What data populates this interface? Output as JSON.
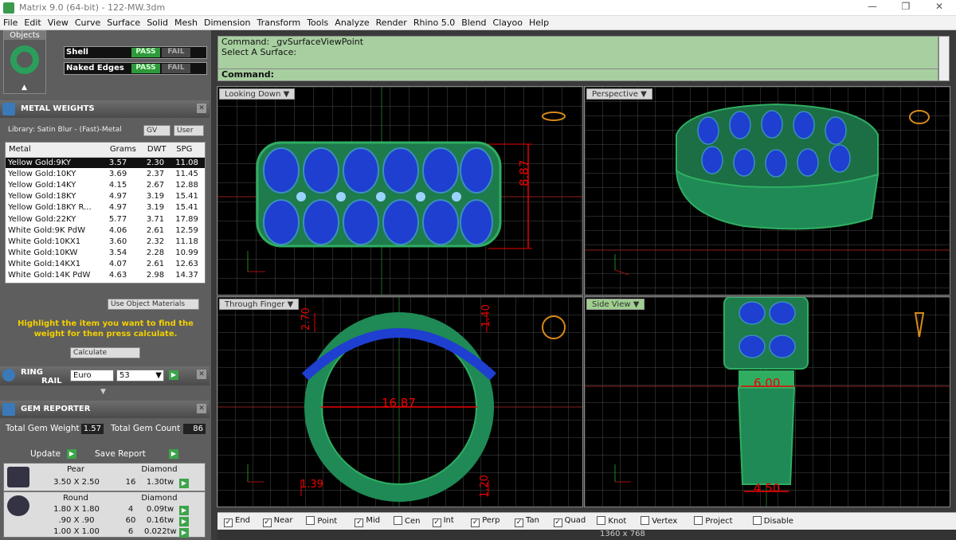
{
  "window": {
    "title": "Matrix 9.0 (64-bit) - 122-MW.3dm"
  },
  "menu": [
    "File",
    "Edit",
    "View",
    "Curve",
    "Surface",
    "Solid",
    "Mesh",
    "Dimension",
    "Transform",
    "Tools",
    "Analyze",
    "Render",
    "Rhino 5.0",
    "Blend",
    "Clayoo",
    "Help"
  ],
  "objects": {
    "label": "Objects"
  },
  "checks": [
    {
      "name": "Shell",
      "pass": "PASS",
      "fail": "FAIL"
    },
    {
      "name": "Naked Edges",
      "pass": "PASS",
      "fail": "FAIL"
    }
  ],
  "metal_weights": {
    "title": "METAL WEIGHTS",
    "library": "Library: Satin Blur - (Fast)-Metal",
    "gv": "GV",
    "user": "User",
    "columns": [
      "Metal",
      "Grams",
      "DWT",
      "SPG"
    ],
    "rows": [
      [
        "Yellow Gold:9KY",
        "3.57",
        "2.30",
        "11.08"
      ],
      [
        "Yellow Gold:10KY",
        "3.69",
        "2.37",
        "11.45"
      ],
      [
        "Yellow Gold:14KY",
        "4.15",
        "2.67",
        "12.88"
      ],
      [
        "Yellow Gold:18KY",
        "4.97",
        "3.19",
        "15.41"
      ],
      [
        "Yellow Gold:18KY R...",
        "4.97",
        "3.19",
        "15.41"
      ],
      [
        "Yellow Gold:22KY",
        "5.77",
        "3.71",
        "17.89"
      ],
      [
        "White Gold:9K PdW",
        "4.06",
        "2.61",
        "12.59"
      ],
      [
        "White Gold:10KX1",
        "3.60",
        "2.32",
        "11.18"
      ],
      [
        "White Gold:10KW",
        "3.54",
        "2.28",
        "10.99"
      ],
      [
        "White Gold:14KX1",
        "4.07",
        "2.61",
        "12.63"
      ],
      [
        "White Gold:14K PdW",
        "4.63",
        "2.98",
        "14.37"
      ]
    ],
    "use_object_materials": "Use Object Materials",
    "hint": "Highlight the item you want to find the weight for then press calculate.",
    "calculate": "Calculate"
  },
  "ring_rail": {
    "title1": "RING",
    "title2": "RAIL",
    "standard": "Euro",
    "size": "53"
  },
  "gem_reporter": {
    "title": "GEM REPORTER",
    "total_weight_label": "Total Gem Weight",
    "total_weight": "1.57",
    "total_count_label": "Total Gem Count",
    "total_count": "86",
    "update": "Update",
    "save_report": "Save Report",
    "groups": [
      {
        "shape": "Pear",
        "material": "Diamond",
        "rows": [
          [
            "3.50 X 2.50",
            "16",
            "1.30tw"
          ]
        ]
      },
      {
        "shape": "Round",
        "material": "Diamond",
        "rows": [
          [
            "1.80 X 1.80",
            "4",
            "0.09tw"
          ],
          [
            ".90 X .90",
            "60",
            "0.16tw"
          ],
          [
            "1.00 X 1.00",
            "6",
            "0.022tw"
          ]
        ]
      }
    ]
  },
  "command": {
    "line1": "Command: _gvSurfaceViewPoint",
    "line2": "Select A Surface:",
    "prompt": "Command:"
  },
  "viewports": [
    {
      "label": "Looking Down",
      "dims": [
        "8.87"
      ]
    },
    {
      "label": "Perspective",
      "dims": []
    },
    {
      "label": "Through Finger",
      "dims": [
        "16.87",
        "2.70",
        "1.40",
        "1.39",
        "1.20"
      ]
    },
    {
      "label": "Side View",
      "dims": [
        "6.00",
        "4.50"
      ]
    }
  ],
  "osnaps": [
    {
      "label": "End",
      "checked": true
    },
    {
      "label": "Near",
      "checked": true
    },
    {
      "label": "Point",
      "checked": false
    },
    {
      "label": "Mid",
      "checked": true
    },
    {
      "label": "Cen",
      "checked": false
    },
    {
      "label": "Int",
      "checked": true
    },
    {
      "label": "Perp",
      "checked": true
    },
    {
      "label": "Tan",
      "checked": true
    },
    {
      "label": "Quad",
      "checked": true
    },
    {
      "label": "Knot",
      "checked": false
    },
    {
      "label": "Vertex",
      "checked": false
    },
    {
      "label": "Project",
      "checked": false
    },
    {
      "label": "Disable",
      "checked": false
    }
  ],
  "status": {
    "resolution": "1360 x 768"
  },
  "colors": {
    "ring_green": "#2b9e5c",
    "gem_blue": "#1f3fd0",
    "dim_red": "#e00000",
    "grid": "#555555",
    "cmd_green": "#a8cfa0"
  }
}
